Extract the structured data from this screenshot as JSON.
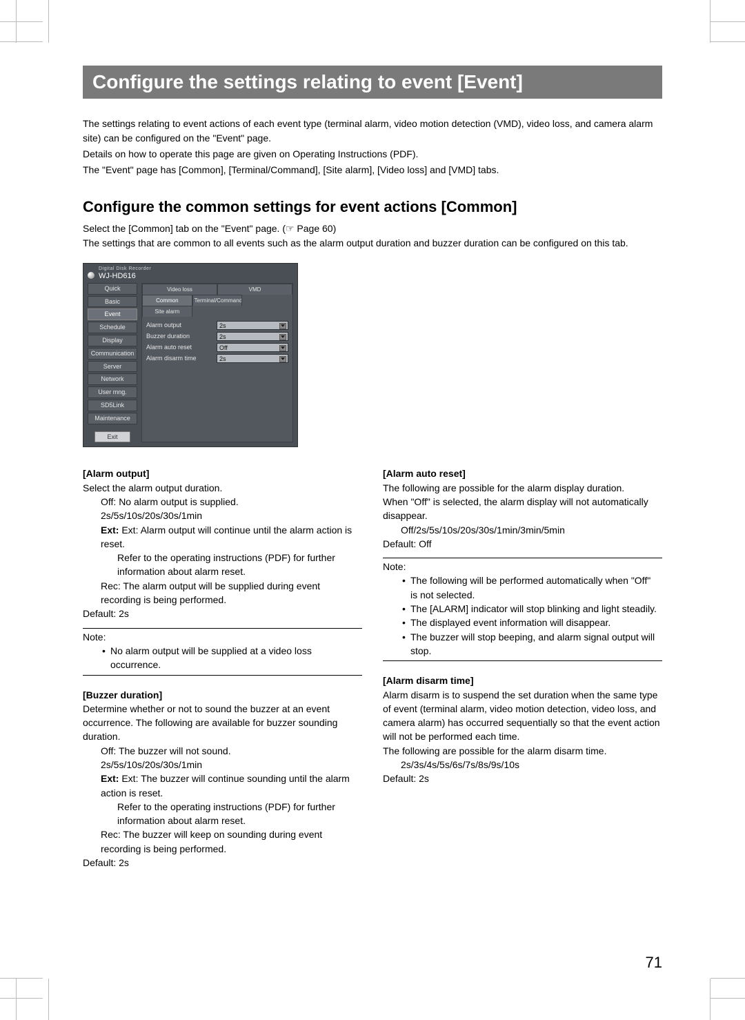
{
  "banner": "Configure the settings relating to event [Event]",
  "intro": [
    "The settings relating to event actions of each event type (terminal alarm, video motion detection (VMD), video loss, and camera alarm site) can be configured on the \"Event\" page.",
    "Details on how to operate this page are given on Operating Instructions (PDF).",
    "The \"Event\" page has [Common], [Terminal/Command], [Site alarm], [Video loss] and [VMD] tabs."
  ],
  "section_heading": "Configure the common settings for event actions [Common]",
  "sub_intro": [
    "Select the [Common] tab on the \"Event\" page. (☞ Page 60)",
    "The settings that are common to all events such as the alarm output duration and buzzer duration can be configured on this tab."
  ],
  "screenshot": {
    "subtitle": "Digital Disk Recorder",
    "model": "WJ-HD616",
    "sidebar": [
      "Quick",
      "Basic",
      "Event",
      "Schedule",
      "Display",
      "Communication",
      "Server",
      "Network",
      "User mng.",
      "SD5Link",
      "Maintenance"
    ],
    "exit_label": "Exit",
    "tabs_row1": [
      "Video loss",
      "VMD"
    ],
    "tabs_row2": [
      "Common",
      "Terminal/Command alarm",
      "Site alarm"
    ],
    "active_tab": "Common",
    "rows": [
      {
        "label": "Alarm output",
        "value": "2s"
      },
      {
        "label": "Buzzer duration",
        "value": "2s"
      },
      {
        "label": "Alarm auto reset",
        "value": "Off"
      },
      {
        "label": "Alarm disarm time",
        "value": "2s"
      }
    ]
  },
  "left": {
    "alarm_output": {
      "title": "[Alarm output]",
      "lead": "Select the alarm output duration.",
      "off": "Off: No alarm output is supplied.",
      "opts": "2s/5s/10s/20s/30s/1min",
      "ext1": "Ext: Alarm output will continue until the alarm action is reset.",
      "ext2": "Refer to the operating instructions (PDF) for further information about alarm reset.",
      "rec": "Rec: The alarm output will be supplied during event recording is being performed.",
      "default": "Default: 2s",
      "note_label": "Note:",
      "note_item": "No alarm output will be supplied at a video loss occurrence."
    },
    "buzzer": {
      "title": "[Buzzer duration]",
      "lead": "Determine whether or not to sound the buzzer at an event occurrence. The following are available for buzzer sounding duration.",
      "off": "Off: The buzzer will not sound.",
      "opts": "2s/5s/10s/20s/30s/1min",
      "ext1": "Ext: The buzzer will continue sounding until the alarm action is reset.",
      "ext2": "Refer to the operating instructions (PDF) for further information about alarm reset.",
      "rec": "Rec: The buzzer will keep on sounding during event recording is being performed.",
      "default": "Default: 2s"
    }
  },
  "right": {
    "auto_reset": {
      "title": "[Alarm auto reset]",
      "lead1": "The following are possible for the alarm display duration.",
      "lead2": "When \"Off\" is selected, the alarm display will not automatically disappear.",
      "opts": "Off/2s/5s/10s/20s/30s/1min/3min/5min",
      "default": "Default: Off",
      "note_label": "Note:",
      "notes": [
        "The following will be performed automatically when \"Off\" is not selected.",
        "The [ALARM] indicator will stop blinking and light steadily.",
        "The displayed event information will disappear.",
        "The buzzer will stop beeping, and alarm signal output will stop."
      ]
    },
    "disarm": {
      "title": "[Alarm disarm time]",
      "lead": "Alarm disarm is to suspend the set duration when the same type of event (terminal alarm, video motion detection, video loss, and camera alarm) has occurred sequentially so that the event action will not be performed each time.",
      "lead2": "The following are possible for the alarm disarm time.",
      "opts": "2s/3s/4s/5s/6s/7s/8s/9s/10s",
      "default": "Default: 2s"
    }
  },
  "page_number": "71"
}
